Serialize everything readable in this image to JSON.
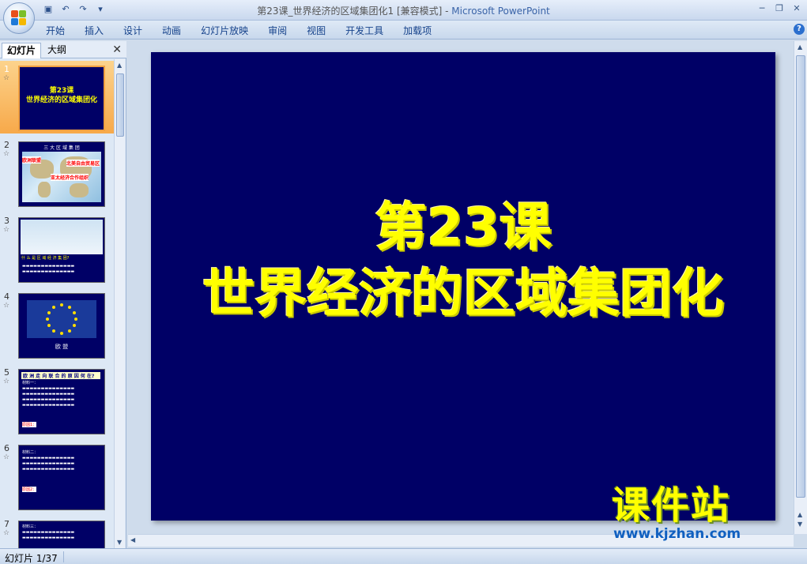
{
  "window": {
    "title_doc": "第23课_世界经济的区域集团化1 [兼容模式] - ",
    "title_app": "Microsoft PowerPoint"
  },
  "ribbon": {
    "tabs": [
      "开始",
      "插入",
      "设计",
      "动画",
      "幻灯片放映",
      "审阅",
      "视图",
      "开发工具",
      "加载项"
    ]
  },
  "panel": {
    "tab_slides": "幻灯片",
    "tab_outline": "大纲"
  },
  "thumbnails": [
    {
      "num": "1",
      "text_lines": [
        "第23课",
        "世界经济的区域集团化"
      ]
    },
    {
      "num": "2",
      "header": "三 大 区 域 集 团",
      "tags": [
        "欧洲联盟",
        "北美自由贸易区",
        "亚太经济合作组织"
      ]
    },
    {
      "num": "3",
      "text": "什 么 是 区 域 经 济 集 团?"
    },
    {
      "num": "4",
      "label": "欧 盟"
    },
    {
      "num": "5",
      "header": "欧 洲 走 向 联 合 的 原 因 何 在?",
      "sub": "材料一：",
      "red": "原因1："
    },
    {
      "num": "6",
      "sub": "材料二：",
      "red": "原因2："
    },
    {
      "num": "7",
      "sub": "材料三："
    }
  ],
  "slide": {
    "line1": "第23课",
    "line2": "世界经济的区域集团化"
  },
  "watermark": {
    "cn": "课件站",
    "url": "www.kjzhan.com"
  },
  "status": {
    "slide_indicator": "幻灯片 1/37"
  }
}
